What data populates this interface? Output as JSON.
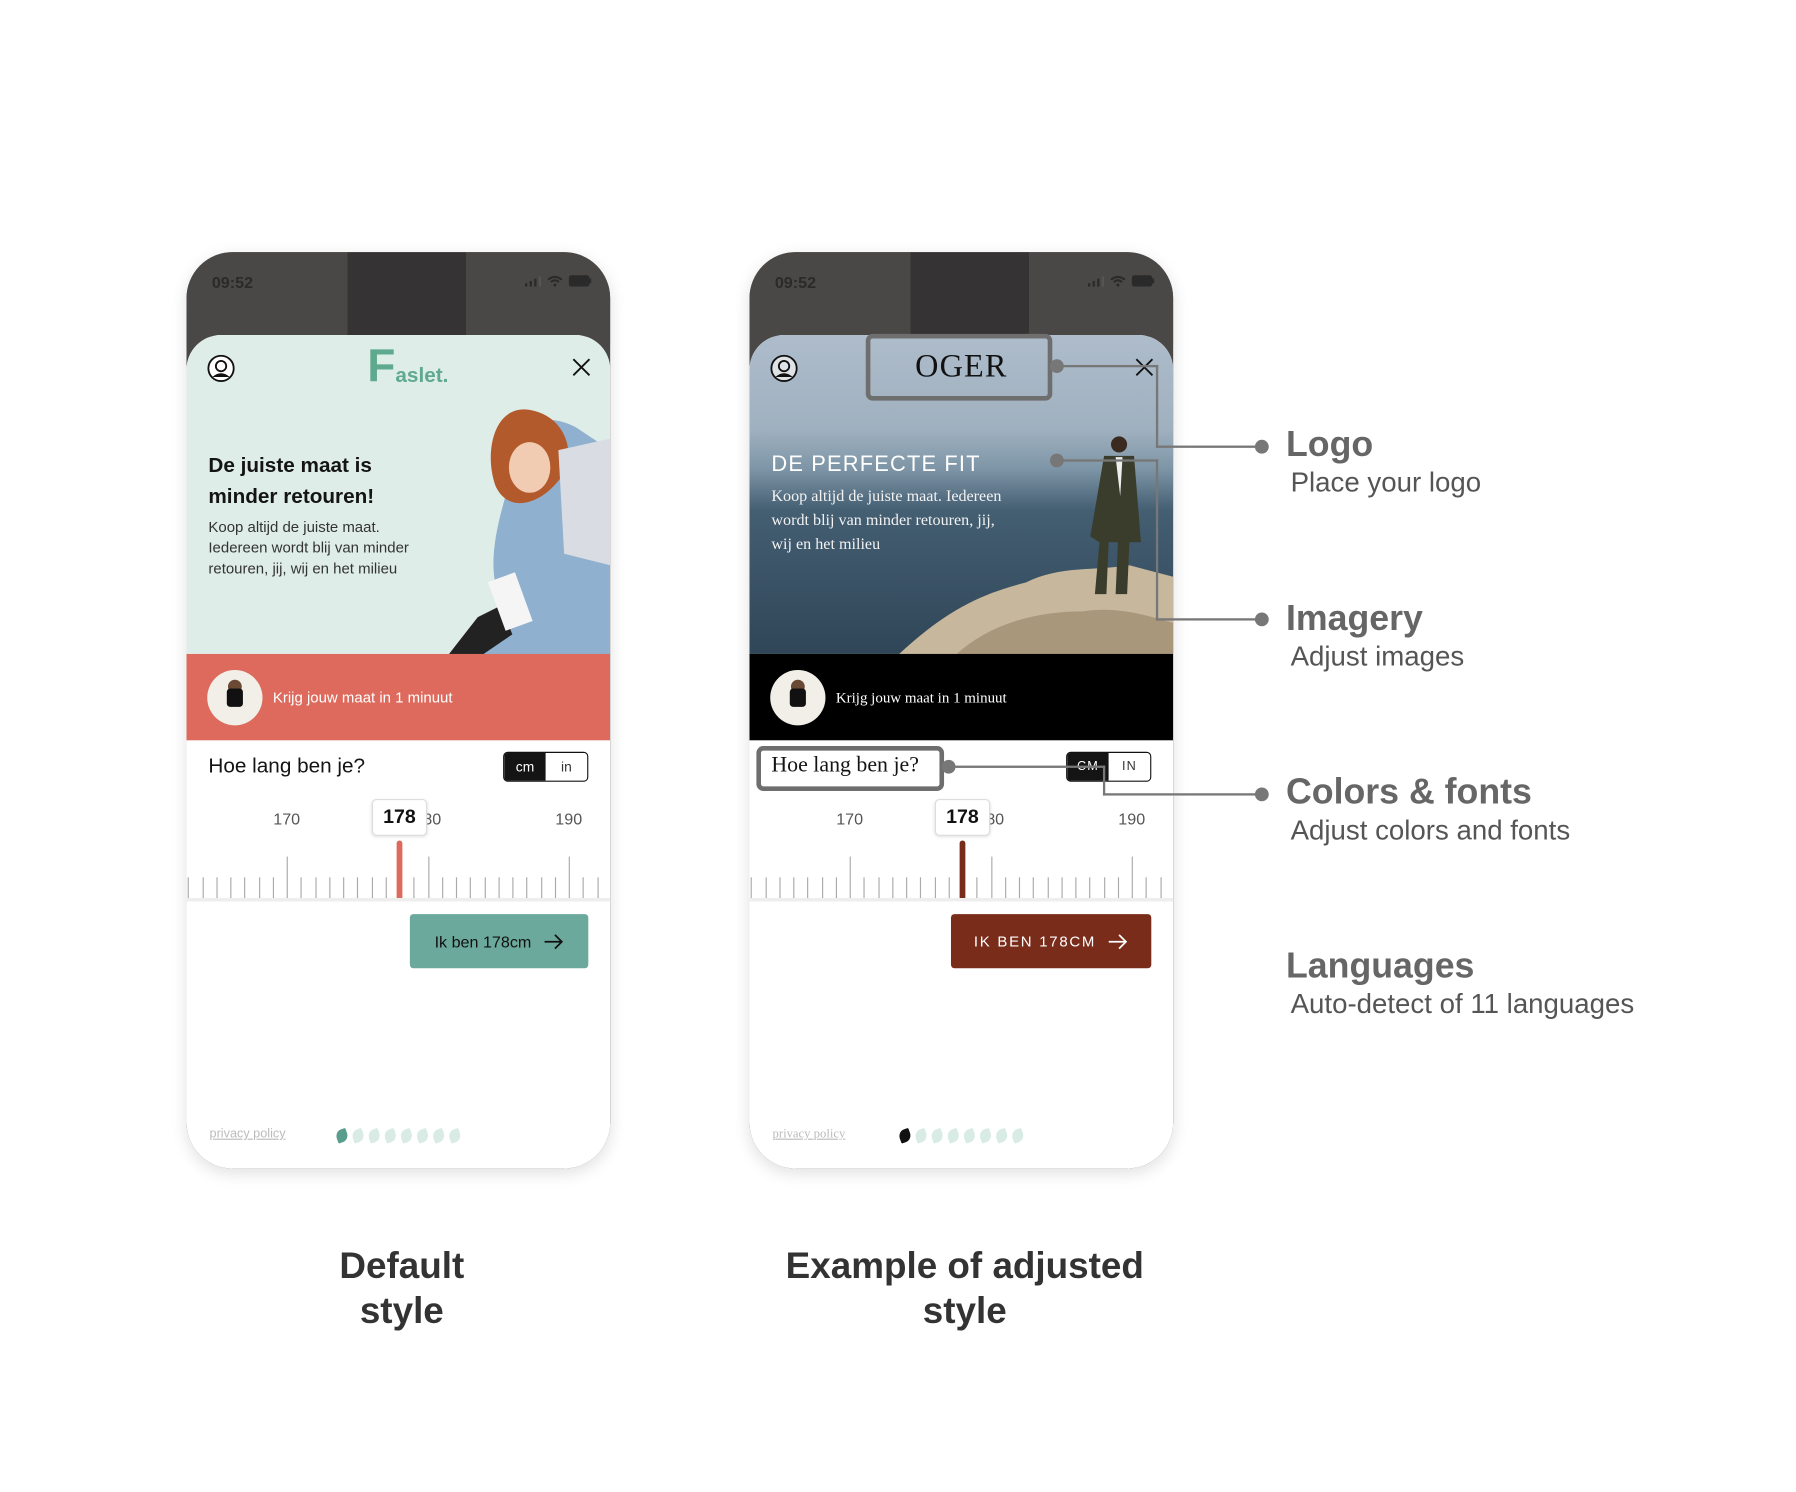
{
  "phones": [
    {
      "status_time": "09:52",
      "logo": {
        "initial": "F",
        "rest": "aslet."
      },
      "hero_title": "De juiste maat is minder retouren!",
      "hero_body": "Koop altijd de juiste maat. Iedereen wordt blij van minder retouren, jij, wij en het milieu",
      "band_text": "Krijg jouw maat in 1 minuut",
      "question": "Hoe lang ben je?",
      "units": [
        "cm",
        "in"
      ],
      "selected_unit": "cm",
      "ruler": {
        "labels": [
          "170",
          "180",
          "190"
        ],
        "value": 178,
        "bubble": "178"
      },
      "cta_label": "Ik ben 178cm",
      "privacy": "privacy policy",
      "progress_step": 1,
      "progress_total": 8,
      "colors": {
        "accent": "#6aa99b",
        "band": "#dd6a5c",
        "hero_bg": "#dfede8"
      }
    },
    {
      "status_time": "09:52",
      "logo": {
        "text": "OGER"
      },
      "hero_title": "DE PERFECTE FIT",
      "hero_body": "Koop altijd de juiste maat. Iedereen wordt blij van minder retouren, jij, wij en het milieu",
      "band_text": "Krijg jouw maat in 1 minuut",
      "question": "Hoe lang ben je?",
      "units": [
        "CM",
        "IN"
      ],
      "selected_unit": "CM",
      "ruler": {
        "labels": [
          "170",
          "180",
          "190"
        ],
        "value": 178,
        "bubble": "178"
      },
      "cta_label": "IK BEN 178CM",
      "privacy": "privacy policy",
      "progress_step": 1,
      "progress_total": 8,
      "colors": {
        "accent": "#7a2c1a",
        "band": "#000000"
      }
    }
  ],
  "annotations": [
    {
      "title": "Logo",
      "subtitle": "Place your logo"
    },
    {
      "title": "Imagery",
      "subtitle": "Adjust images"
    },
    {
      "title": "Colors & fonts",
      "subtitle": "Adjust colors and fonts"
    },
    {
      "title": "Languages",
      "subtitle": "Auto-detect of 11 languages"
    }
  ],
  "captions": {
    "default": [
      "Default",
      "style"
    ],
    "adjusted": [
      "Example of adjusted",
      "style"
    ]
  }
}
